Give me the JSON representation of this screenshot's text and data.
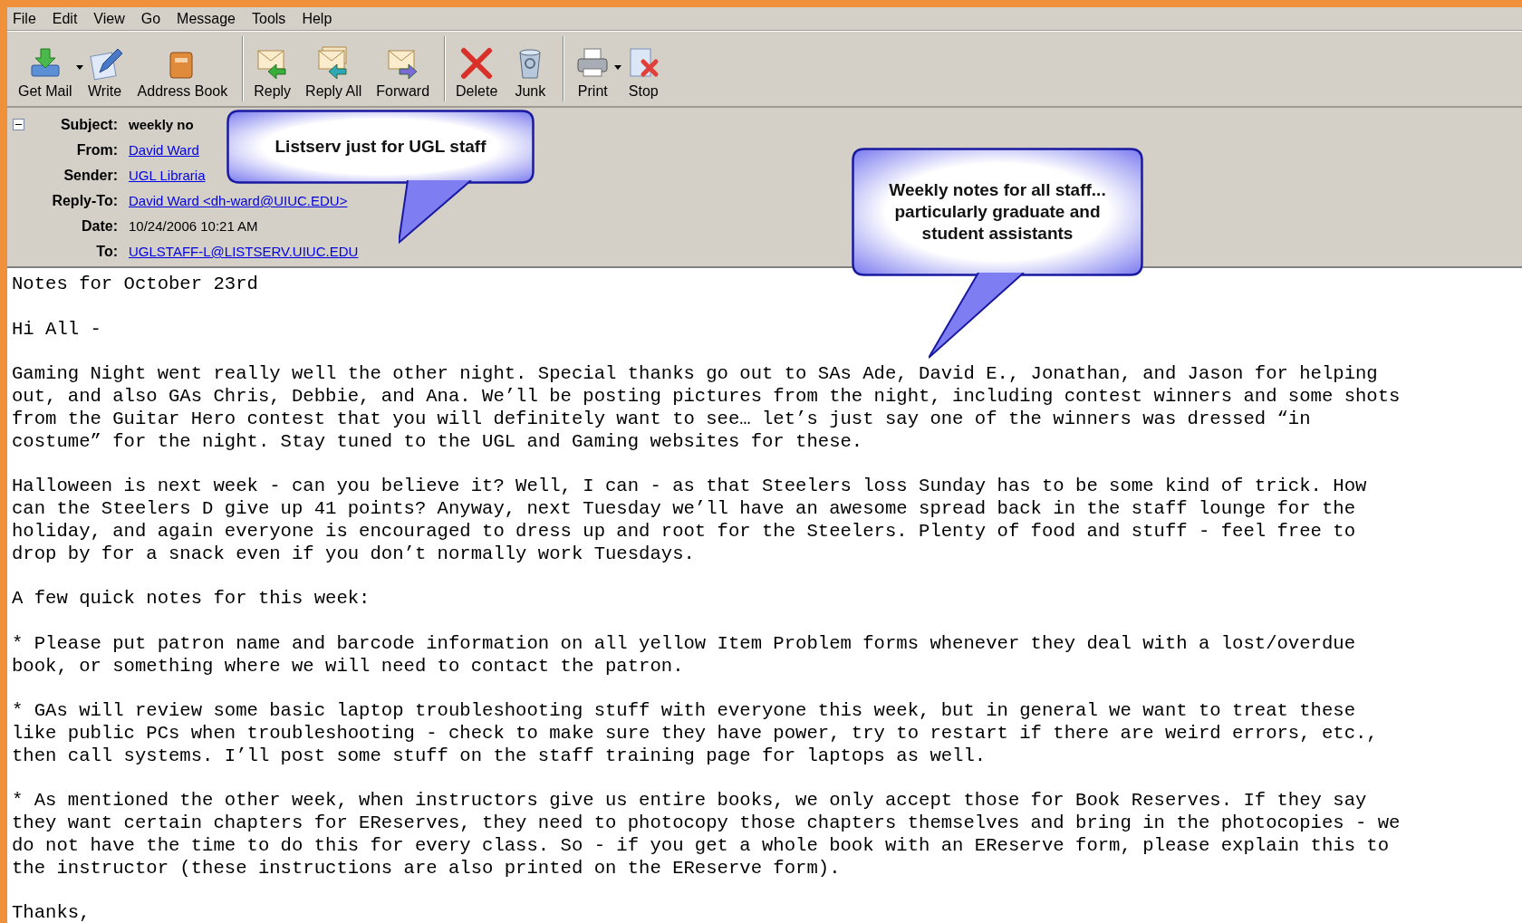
{
  "menu": [
    {
      "label": "File"
    },
    {
      "label": "Edit"
    },
    {
      "label": "View"
    },
    {
      "label": "Go"
    },
    {
      "label": "Message"
    },
    {
      "label": "Tools"
    },
    {
      "label": "Help"
    }
  ],
  "toolbar": {
    "groups": [
      [
        {
          "label": "Get Mail",
          "kind": "getmail",
          "dropdown": true
        },
        {
          "label": "Write",
          "kind": "write",
          "dropdown": false
        },
        {
          "label": "Address Book",
          "kind": "addressbook",
          "dropdown": false
        }
      ],
      [
        {
          "label": "Reply",
          "kind": "reply",
          "dropdown": false
        },
        {
          "label": "Reply All",
          "kind": "replyall",
          "dropdown": false
        },
        {
          "label": "Forward",
          "kind": "forward",
          "dropdown": false
        }
      ],
      [
        {
          "label": "Delete",
          "kind": "delete",
          "dropdown": false
        },
        {
          "label": "Junk",
          "kind": "junk",
          "dropdown": false
        }
      ],
      [
        {
          "label": "Print",
          "kind": "print",
          "dropdown": true
        },
        {
          "label": "Stop",
          "kind": "stop",
          "dropdown": false
        }
      ]
    ]
  },
  "header": {
    "expanded": true,
    "fields": [
      {
        "label": "Subject:",
        "value": "weekly no",
        "kind": "bold"
      },
      {
        "label": "From:",
        "value": "David Ward",
        "kind": "link"
      },
      {
        "label": "Sender:",
        "value": "UGL Libraria",
        "kind": "link"
      },
      {
        "label": "Reply-To:",
        "value": "David Ward <dh-ward@UIUC.EDU>",
        "kind": "link"
      },
      {
        "label": "Date:",
        "value": "10/24/2006 10:21 AM",
        "kind": "plain"
      },
      {
        "label": "To:",
        "value": "UGLSTAFF-L@LISTSERV.UIUC.EDU",
        "kind": "link"
      }
    ]
  },
  "body": [
    [
      "Notes for October 23rd"
    ],
    [
      "Hi All -"
    ],
    [
      "Gaming Night went really well the other night. Special thanks go out to SAs Ade, David E., Jonathan, and Jason for helping",
      "out, and also GAs Chris, Debbie, and Ana. We’ll be posting pictures from the night, including contest winners and some shots",
      "from the Guitar Hero contest that you will definitely want to see… let’s just say one of the winners was dressed “in",
      "costume” for the night. Stay tuned to the UGL and Gaming websites for these."
    ],
    [
      "Halloween is next week - can you believe it? Well, I can - as that Steelers loss Sunday has to be some kind of trick. How",
      "can the Steelers D give up 41 points? Anyway, next Tuesday we’ll have an awesome spread back in the staff lounge for the",
      "holiday, and again everyone is encouraged to dress up and root for the Steelers. Plenty of food and stuff - feel free to",
      "drop by for a snack even if you don’t normally work Tuesdays."
    ],
    [
      "A few quick notes for this week:"
    ],
    [
      "* Please put patron name and barcode information on all yellow Item Problem forms whenever they deal with a lost/overdue",
      "book, or something where we will need to contact the patron."
    ],
    [
      "* GAs will review some basic laptop troubleshooting stuff with everyone this week, but in general we want to treat these",
      "like public PCs when troubleshooting - check to make sure they have power, try to restart if there are weird errors, etc.,",
      "then call systems. I’ll post some stuff on the staff training page for laptops as well."
    ],
    [
      "* As mentioned the other week, when instructors give us entire books, we only accept those for Book Reserves. If they say",
      "they want certain chapters for EReserves, they need to photocopy those chapters themselves and bring in the photocopies - we",
      "do not have the time to do this for every class. So - if you get a whole book with an EReserve form, please explain this to",
      "the instructor (these instructions are also printed on the EReserve form)."
    ],
    [
      "Thanks,"
    ]
  ],
  "callouts": [
    {
      "lines": [
        "Listserv just for UGL staff"
      ]
    },
    {
      "lines": [
        "Weekly notes for all staff...",
        "particularly graduate and",
        "student assistants"
      ]
    }
  ]
}
